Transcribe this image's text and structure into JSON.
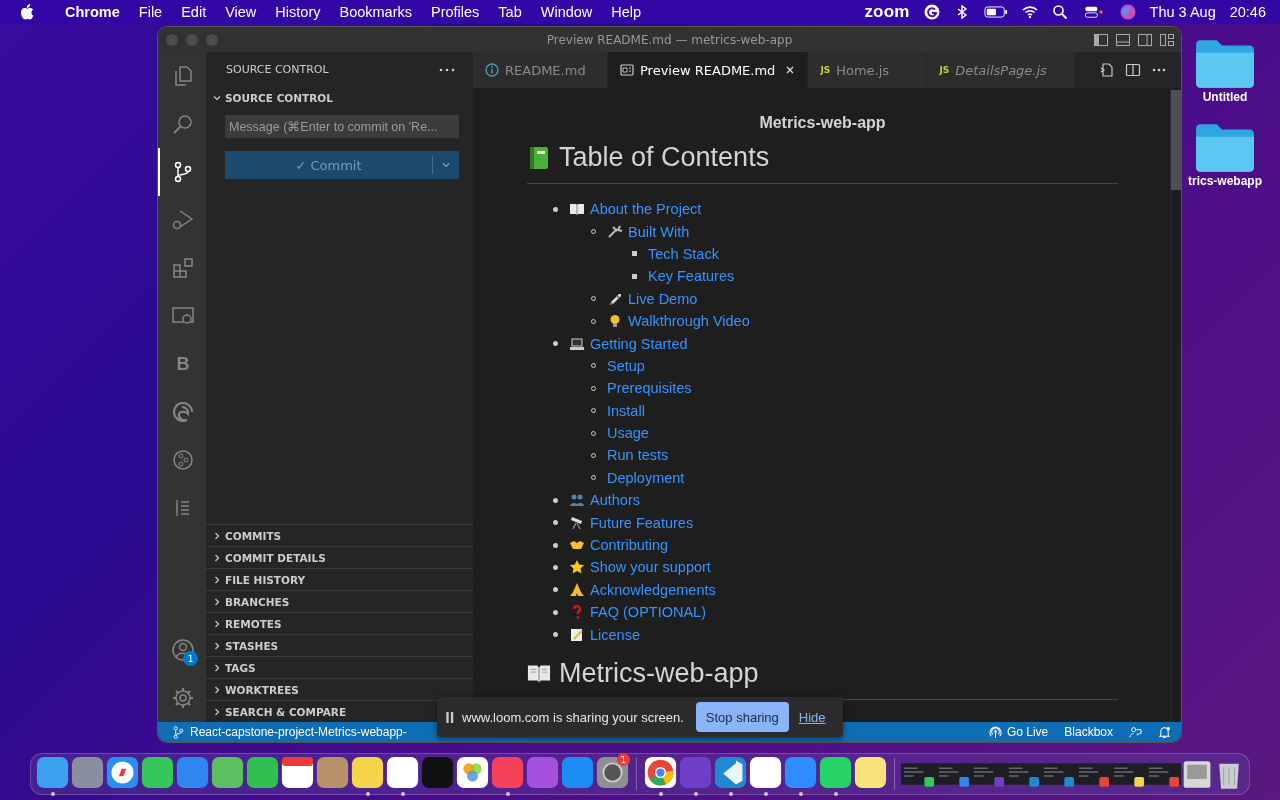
{
  "menu_bar": {
    "app": "Chrome",
    "items": [
      "File",
      "Edit",
      "View",
      "History",
      "Bookmarks",
      "Profiles",
      "Tab",
      "Window",
      "Help"
    ],
    "status_text": "zoom",
    "date": "Thu 3 Aug",
    "time": "20:46"
  },
  "desktop_icons": [
    {
      "label": "Untitled"
    },
    {
      "label": "trics-webapp"
    }
  ],
  "window": {
    "title": "Preview README.md — metrics-web-app"
  },
  "activity_bar": {
    "items": [
      {
        "selected": false
      },
      {
        "selected": false
      },
      {
        "selected": true
      },
      {
        "selected": false
      },
      {
        "selected": false
      },
      {
        "selected": false
      },
      {
        "selected": false,
        "text": "B"
      },
      {
        "selected": false
      },
      {
        "selected": false
      },
      {
        "selected": false
      }
    ],
    "account_badge": "1"
  },
  "sidebar": {
    "title": "SOURCE CONTROL",
    "section": {
      "label": "SOURCE CONTROL",
      "expanded": true
    },
    "message_placeholder": "Message (⌘Enter to commit on 'Re...",
    "commit_button": "✓ Commit",
    "sections": [
      {
        "label": "COMMITS",
        "expanded": false
      },
      {
        "label": "COMMIT DETAILS",
        "expanded": false
      },
      {
        "label": "FILE HISTORY",
        "expanded": false
      },
      {
        "label": "BRANCHES",
        "expanded": false
      },
      {
        "label": "REMOTES",
        "expanded": false
      },
      {
        "label": "STASHES",
        "expanded": false
      },
      {
        "label": "TAGS",
        "expanded": false
      },
      {
        "label": "WORKTREES",
        "expanded": false
      },
      {
        "label": "SEARCH & COMPARE",
        "expanded": false
      }
    ]
  },
  "tabs": [
    {
      "label": "README.md",
      "kind": "info",
      "selected": false,
      "italic": false
    },
    {
      "label": "Preview README.md",
      "kind": "preview",
      "selected": true,
      "italic": false
    },
    {
      "label": "Home.js",
      "kind": "js",
      "badge": "JS",
      "selected": false,
      "italic": false
    },
    {
      "label": "DetailsPage.js",
      "kind": "js",
      "badge": "JS",
      "selected": false,
      "italic": true
    }
  ],
  "preview": {
    "title": "Metrics-web-app",
    "toc_heading": "Table of Contents",
    "toc": [
      {
        "label": "About the Project",
        "children": [
          {
            "label": "Built With",
            "children": [
              {
                "label": "Tech Stack"
              },
              {
                "label": "Key Features"
              }
            ]
          },
          {
            "label": "Live Demo"
          },
          {
            "label": "Walkthrough Video"
          }
        ]
      },
      {
        "label": "Getting Started",
        "children": [
          {
            "label": "Setup"
          },
          {
            "label": "Prerequisites"
          },
          {
            "label": "Install"
          },
          {
            "label": "Usage"
          },
          {
            "label": "Run tests"
          },
          {
            "label": "Deployment"
          }
        ]
      },
      {
        "label": "Authors"
      },
      {
        "label": "Future Features"
      },
      {
        "label": "Contributing"
      },
      {
        "label": "Show your support"
      },
      {
        "label": "Acknowledgements"
      },
      {
        "label": "FAQ (OPTIONAL)"
      },
      {
        "label": "License"
      }
    ],
    "next_heading": "Metrics-web-app"
  },
  "status_bar": {
    "branch": "React-capstone-project-Metrics-webapp-",
    "go_live": "Go Live",
    "blackbox": "Blackbox"
  },
  "share_banner": {
    "text": "www.loom.com is sharing your screen.",
    "stop_button": "Stop sharing",
    "hide_link": "Hide"
  },
  "dock": {
    "items": [
      {
        "running": true
      },
      {
        "running": false
      },
      {
        "running": false
      },
      {
        "running": false
      },
      {
        "running": false
      },
      {
        "running": false
      },
      {
        "running": false
      },
      {
        "running": false
      },
      {
        "running": false
      },
      {
        "running": true
      },
      {
        "running": true
      },
      {
        "running": false
      },
      {
        "running": false
      },
      {
        "running": true
      },
      {
        "running": false
      },
      {
        "running": false
      },
      {
        "running": false,
        "badge": "1"
      },
      {
        "running": true
      },
      {
        "running": true
      },
      {
        "running": true
      },
      {
        "running": true
      },
      {
        "running": true
      },
      {
        "running": true
      },
      {
        "running": false
      }
    ]
  }
}
